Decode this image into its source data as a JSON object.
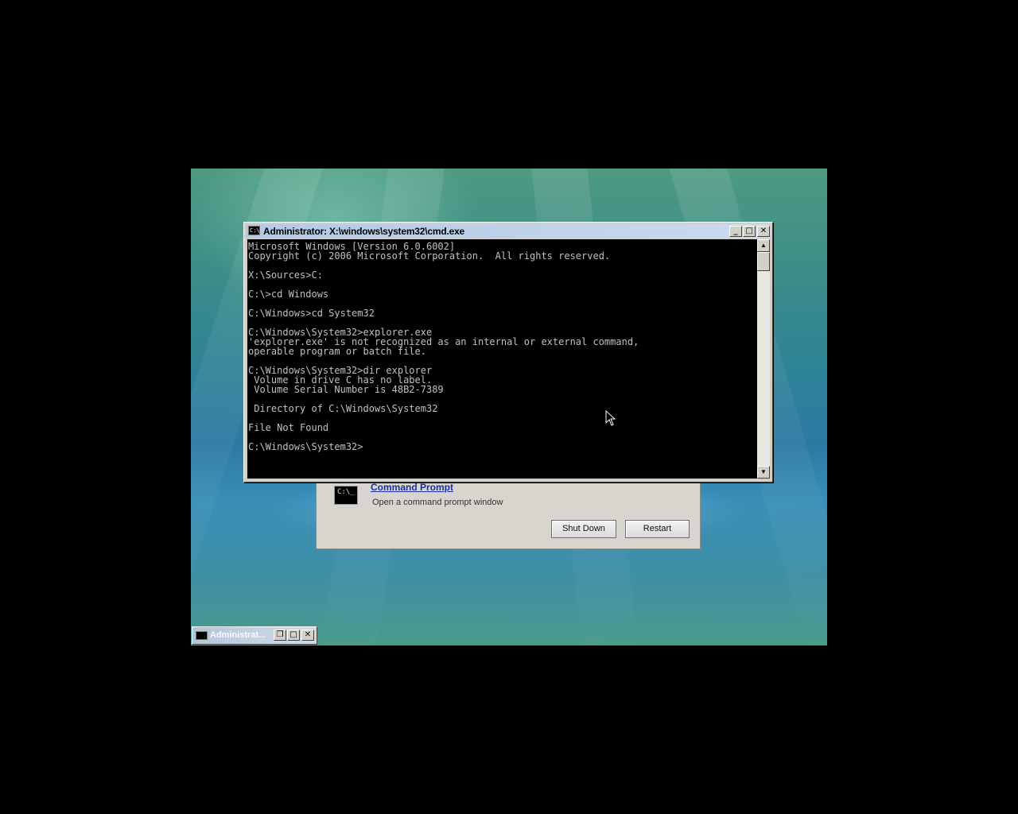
{
  "cmd_window": {
    "title": "Administrator: X:\\windows\\system32\\cmd.exe",
    "icon_text": "C:\\",
    "buttons": {
      "minimize": "_",
      "maximize": "□",
      "close": "✕"
    },
    "lines": [
      "Microsoft Windows [Version 6.0.6002]",
      "Copyright (c) 2006 Microsoft Corporation.  All rights reserved.",
      "",
      "X:\\Sources>C:",
      "",
      "C:\\>cd Windows",
      "",
      "C:\\Windows>cd System32",
      "",
      "C:\\Windows\\System32>explorer.exe",
      "'explorer.exe' is not recognized as an internal or external command,",
      "operable program or batch file.",
      "",
      "C:\\Windows\\System32>dir explorer",
      " Volume in drive C has no label.",
      " Volume Serial Number is 48B2-7389",
      "",
      " Directory of C:\\Windows\\System32",
      "",
      "File Not Found",
      "",
      "C:\\Windows\\System32>"
    ],
    "scrollbar": {
      "up": "▲",
      "down": "▼"
    }
  },
  "recovery_dialog": {
    "item_title": "Command Prompt",
    "item_description": "Open a command prompt window",
    "icon_text": "C:\\_",
    "shutdown_label": "Shut Down",
    "restart_label": "Restart"
  },
  "minimized_window": {
    "title": "Administrat...",
    "buttons": {
      "restore": "❐",
      "maximize": "□",
      "close": "✕"
    }
  },
  "colors": {
    "console_bg": "#000000",
    "console_text": "#c0c0c0",
    "link": "#1b2fa8"
  }
}
